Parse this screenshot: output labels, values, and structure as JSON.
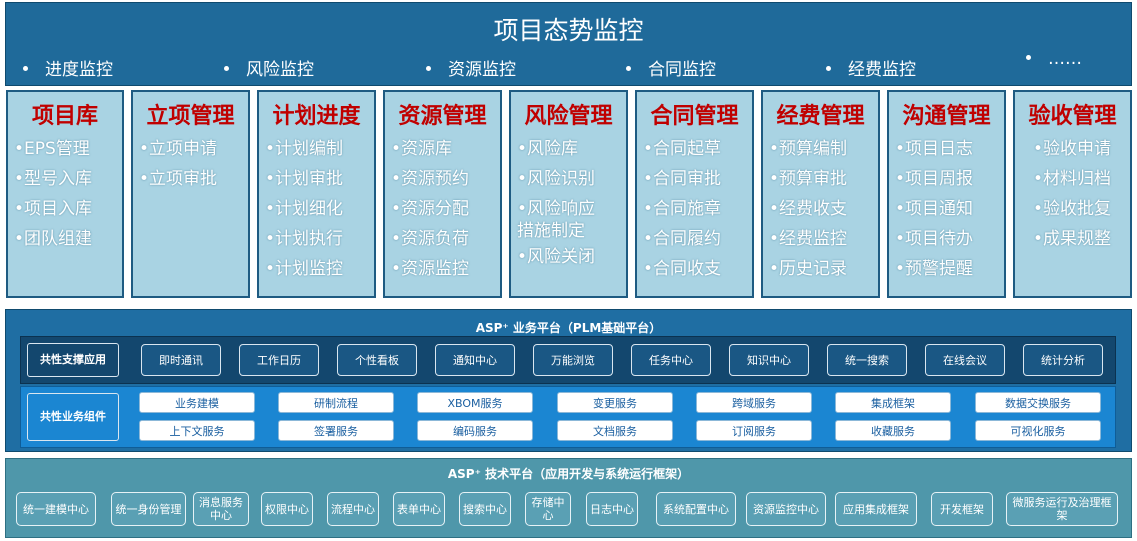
{
  "header": {
    "title": "项目态势监控",
    "monitors": [
      "进度监控",
      "风险监控",
      "资源监控",
      "合同监控",
      "经费监控",
      "……"
    ]
  },
  "modules": [
    {
      "title": "项目库",
      "items": [
        "•EPS管理",
        "•型号入库",
        "•项目入库",
        "•团队组建"
      ]
    },
    {
      "title": "立项管理",
      "items": [
        "•立项申请",
        "•立项审批"
      ]
    },
    {
      "title": "计划进度",
      "items": [
        "•计划编制",
        "•计划审批",
        "•计划细化",
        "•计划执行",
        "•计划监控"
      ]
    },
    {
      "title": "资源管理",
      "items": [
        "•资源库",
        "•资源预约",
        "•资源分配",
        "•资源负荷",
        "•资源监控"
      ]
    },
    {
      "title": "风险管理",
      "items": [
        "•风险库",
        "•风险识别",
        "•风险响应",
        "措施制定",
        "•风险关闭"
      ]
    },
    {
      "title": "合同管理",
      "items": [
        "•合同起草",
        "•合同审批",
        "•合同施章",
        "•合同履约",
        "•合同收支"
      ]
    },
    {
      "title": "经费管理",
      "items": [
        "•预算编制",
        "•预算审批",
        "•经费收支",
        "•经费监控",
        "•历史记录"
      ]
    },
    {
      "title": "沟通管理",
      "items": [
        "•项目日志",
        "•项目周报",
        "•项目通知",
        "•项目待办",
        "•预警提醒"
      ]
    },
    {
      "title": "验收管理",
      "items": [
        "•验收申请",
        "•材料归档",
        "•验收批复",
        "•成果规整"
      ]
    }
  ],
  "business_platform": {
    "title": "ASP⁺ 业务平台（PLM基础平台）",
    "support_label": "共性支撑应用",
    "support_apps": [
      "即时通讯",
      "工作日历",
      "个性看板",
      "通知中心",
      "万能浏览",
      "任务中心",
      "知识中心",
      "统一搜索",
      "在线会议",
      "统计分析"
    ],
    "component_label": "共性业务组件",
    "components_row1": [
      "业务建模",
      "研制流程",
      "XBOM服务",
      "变更服务",
      "跨域服务",
      "集成框架",
      "数据交换服务"
    ],
    "components_row2": [
      "上下文服务",
      "签署服务",
      "编码服务",
      "文档服务",
      "订阅服务",
      "收藏服务",
      "可视化服务"
    ]
  },
  "tech_platform": {
    "title": "ASP⁺ 技术平台（应用开发与系统运行框架）",
    "items": [
      "统一建模中心",
      "统一身份管理",
      "消息服务中心",
      "权限中心",
      "流程中心",
      "表单中心",
      "搜索中心",
      "存储中心",
      "日志中心",
      "系统配置中心",
      "资源监控中心",
      "应用集成框架",
      "开发框架",
      "微服务运行及治理框架"
    ]
  },
  "colors": {
    "header_bg": "#1f6a9a",
    "module_bg": "#a9d3e3",
    "module_title": "#c00000",
    "biz_bg": "#1f6ea3",
    "tech_bg": "#4f97aa"
  }
}
